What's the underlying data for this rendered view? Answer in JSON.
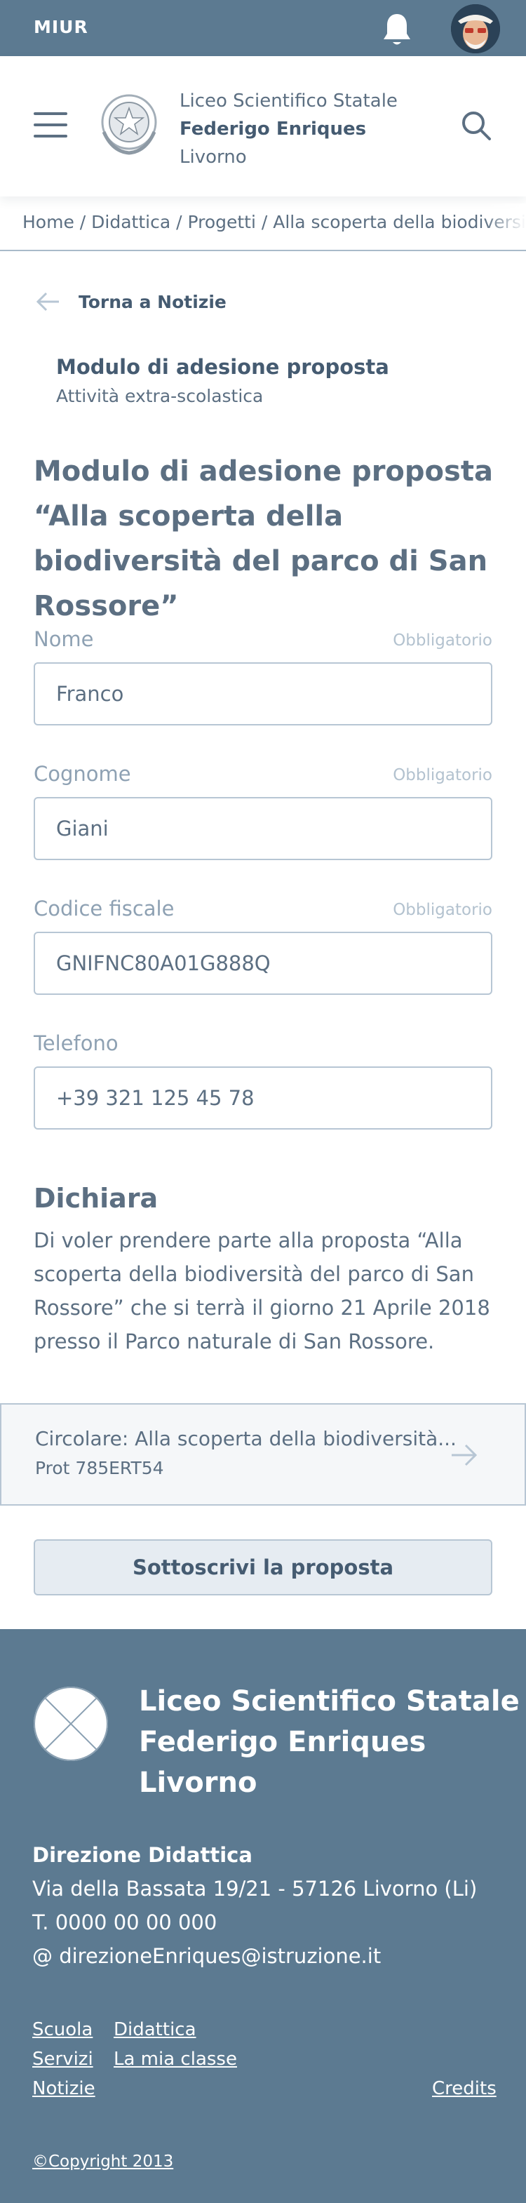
{
  "topbar": {
    "brand": "MIUR",
    "bell_icon": "bell-icon",
    "avatar_icon": "user-avatar"
  },
  "header": {
    "menu_icon": "hamburger-menu-icon",
    "emblem_icon": "italian-republic-emblem",
    "school_line1": "Liceo Scientifico Statale",
    "school_line2": "Federigo Enriques",
    "school_line3": "Livorno",
    "search_icon": "search-icon"
  },
  "breadcrumb": {
    "text": "Home / Didattica / Progetti / Alla scoperta della biodiversità del parco di San Rossore"
  },
  "back": {
    "label": "Torna a Notizie",
    "icon": "arrow-left-icon"
  },
  "form_type": {
    "title": "Modulo di adesione proposta",
    "subtitle": "Attività extra-scolastica"
  },
  "form_title": "Modulo di adesione proposta “Alla scoperta della biodiversità del parco di San Rossore”",
  "fields": [
    {
      "label": "Nome",
      "required": "Obbligatorio",
      "value": "Franco"
    },
    {
      "label": "Cognome",
      "required": "Obbligatorio",
      "value": "Giani"
    },
    {
      "label": "Codice fiscale",
      "required": "Obbligatorio",
      "value": "GNIFNC80A01G888Q"
    },
    {
      "label": "Telefono",
      "required": "",
      "value": "+39 321 125 45 78"
    }
  ],
  "declare": {
    "heading": "Dichiara",
    "text": "Di voler prendere parte alla proposta “Alla scoperta della biodiversità del parco di San Rossore” che si terrà il giorno 21 Aprile 2018 presso il Parco naturale di San Rossore."
  },
  "circolare": {
    "title": "Circolare: Alla scoperta della biodiversità...",
    "prot": "Prot 785ERT54",
    "icon": "arrow-right-icon"
  },
  "submit_label": "Sottoscrivi la proposta",
  "footer": {
    "logo_icon": "logo-placeholder",
    "name_line1": "Liceo Scientifico Statale",
    "name_line2": "Federigo Enriques",
    "name_line3": "Livorno",
    "dept": "Direzione Didattica",
    "address": "Via della Bassata 19/21 - 57126 Livorno (Li)",
    "phone": "T. 0000 00 00 000",
    "email": "@ direzioneEnriques@istruzione.it",
    "links": [
      "Scuola",
      "Didattica",
      "Servizi",
      "La mia classe",
      "Notizie",
      "Credits"
    ],
    "copyright": "©Copyright 2013"
  },
  "colors": {
    "primary": "#5c7a91",
    "text": "#5c6f82",
    "border": "#b7c6d4"
  }
}
